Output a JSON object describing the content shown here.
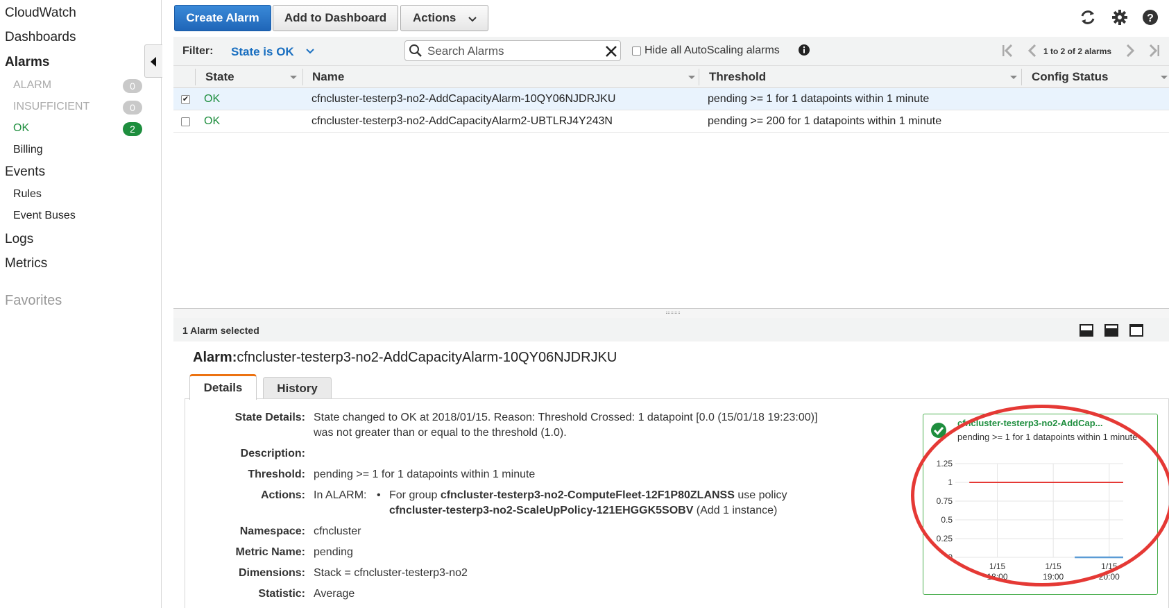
{
  "sidebar": {
    "cloudwatch": "CloudWatch",
    "dashboards": "Dashboards",
    "alarms": "Alarms",
    "alarm_state": {
      "label": "ALARM",
      "count": "0"
    },
    "insufficient_state": {
      "label": "INSUFFICIENT",
      "count": "0"
    },
    "ok_state": {
      "label": "OK",
      "count": "2"
    },
    "billing": "Billing",
    "events": "Events",
    "rules": "Rules",
    "event_buses": "Event Buses",
    "logs": "Logs",
    "metrics": "Metrics",
    "favorites": "Favorites"
  },
  "toolbar": {
    "create_alarm": "Create Alarm",
    "add_to_dashboard": "Add to Dashboard",
    "actions": "Actions"
  },
  "filterbar": {
    "filter_label": "Filter:",
    "filter_value": "State is OK",
    "search_placeholder": "Search Alarms",
    "hide_autoscaling": "Hide all AutoScaling alarms",
    "pagination": "1 to 2 of 2 alarms"
  },
  "table": {
    "headers": {
      "state": "State",
      "name": "Name",
      "threshold": "Threshold",
      "config_status": "Config Status"
    },
    "rows": [
      {
        "checked": true,
        "state": "OK",
        "name": "cfncluster-testerp3-no2-AddCapacityAlarm-10QY06NJDRJKU",
        "threshold": "pending >= 1 for 1 datapoints within 1 minute"
      },
      {
        "checked": false,
        "state": "OK",
        "name": "cfncluster-testerp3-no2-AddCapacityAlarm2-UBTLRJ4Y243N",
        "threshold": "pending >= 200 for 1 datapoints within 1 minute"
      }
    ]
  },
  "details": {
    "selected_count": "1 Alarm selected",
    "alarm_prefix": "Alarm:",
    "alarm_name": "cfncluster-testerp3-no2-AddCapacityAlarm-10QY06NJDRJKU",
    "tabs": {
      "details": "Details",
      "history": "History"
    },
    "labels": {
      "state_details": "State Details:",
      "description": "Description:",
      "threshold": "Threshold:",
      "actions": "Actions:",
      "namespace": "Namespace:",
      "metric_name": "Metric Name:",
      "dimensions": "Dimensions:",
      "statistic": "Statistic:"
    },
    "state_details_line1": "State changed to OK at 2018/01/15. Reason: Threshold Crossed: 1 datapoint [0.0 (15/01/18 19:23:00)]",
    "state_details_line2": "was not greater than or equal to the threshold (1.0).",
    "threshold": "pending >= 1 for 1 datapoints within 1 minute",
    "actions_state": "In ALARM:",
    "actions_bullet": "•",
    "actions_for_group": "For group ",
    "actions_group": "cfncluster-testerp3-no2-ComputeFleet-12F1P80ZLANSS",
    "actions_use_policy": " use policy",
    "actions_policy": "cfncluster-testerp3-no2-ScaleUpPolicy-121EHGGK5SOBV",
    "actions_add": " (Add 1 instance)",
    "namespace": "cfncluster",
    "metric_name": "pending",
    "dimensions": "Stack = cfncluster-testerp3-no2",
    "statistic": "Average"
  },
  "mini_chart": {
    "title": "cfncluster-testerp3-no2-AddCap...",
    "subtitle": "pending >= 1 for 1 datapoints within 1 minute",
    "colors": {
      "threshold": "#e53935",
      "metric": "#5b9bd5",
      "ok": "#1e8e3e"
    }
  },
  "chart_data": {
    "type": "line",
    "title": "cfncluster-testerp3-no2-AddCap...",
    "ylim": [
      0,
      1.25
    ],
    "yticks": [
      "1.25",
      "1",
      "0.75",
      "0.5",
      "0.25",
      "0"
    ],
    "xticks": [
      {
        "date": "1/15",
        "time": "18:00"
      },
      {
        "date": "1/15",
        "time": "19:00"
      },
      {
        "date": "1/15",
        "time": "20:00"
      }
    ],
    "series": [
      {
        "name": "threshold",
        "x": [
          "17:30",
          "20:15"
        ],
        "values": [
          1,
          1
        ],
        "color": "#e53935"
      },
      {
        "name": "pending",
        "x": [
          "19:23",
          "20:15"
        ],
        "values": [
          0,
          0
        ],
        "color": "#5b9bd5"
      }
    ],
    "grid": true
  }
}
